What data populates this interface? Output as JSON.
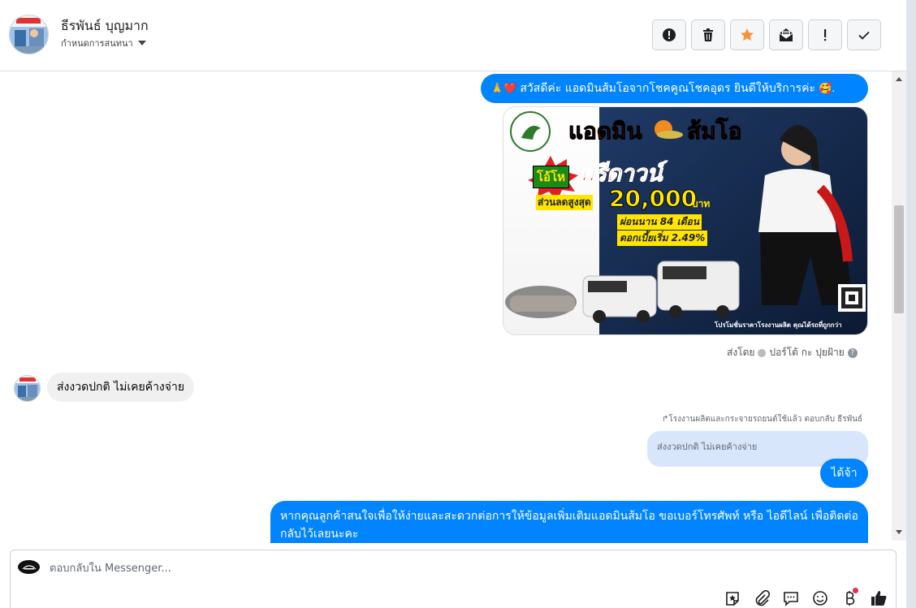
{
  "header": {
    "contact_name": "ธีรพันธ์ บุญมาก",
    "subtitle": "กำหนดการสนทนา",
    "toolbar": [
      {
        "name": "alert-circle-icon"
      },
      {
        "name": "trash-icon"
      },
      {
        "name": "star-icon"
      },
      {
        "name": "mail-open-icon"
      },
      {
        "name": "exclamation-icon"
      },
      {
        "name": "check-icon"
      }
    ]
  },
  "messages": {
    "greeting": {
      "emoji_start": "🙏❤️",
      "text": "สวัสดีค่ะ แอดมินส้มโอจากโชคคูณโชคอุดร ยินดีให้บริการค่ะ",
      "emoji_end": "🥰."
    },
    "promo": {
      "title_1": "แอดมิน",
      "title_2": "ส้มโอ",
      "badge": "โอ้โห",
      "headline": "ฟรีดาวน์",
      "discount_label": "ส่วนลดสูงสุด",
      "discount_amount": "20,000",
      "discount_unit": "บาท",
      "installment": "ผ่อนนาน 84 เดือน",
      "interest": "ดอกเบี้ยเริ่ม 2.49%",
      "footer": "โปรโมชั่นราคาโรงงานผลิต คุณได้รถที่ถูกกว่า"
    },
    "sent_by": {
      "prefix": "ส่งโดย",
      "name": "ปอร์โต้ กะ ปุยฝ้าย"
    },
    "incoming": "ส่งงวดปกติ ไม่เคยค้างจ่าย",
    "reply_note": "↱โรงงานผลิตและกระจายรถยนต์ใช้แล้ว ตอบกลับ ธีรพันธ์",
    "quoted": "ส่งงวดปกติ ไม่เคยค้างจ่าย",
    "reply": "ได้จ้า",
    "long": "หากคุณลูกค้าสนใจเพื่อให้ง่ายและสะดวกต่อการให้ข้อมูลเพิ่มเติมแอดมินส้มโอ ขอเบอร์โทรศัพท์ หรือ ไอดีไลน์ เพื่อติดต่อกลับไว้เลยนะคะ"
  },
  "composer": {
    "placeholder": "ตอบกลับใน Messenger...",
    "icons": [
      "sticker-icon",
      "attachment-icon",
      "saved-reply-icon",
      "emoji-icon",
      "payment-icon",
      "like-icon"
    ]
  },
  "colors": {
    "accent": "#0084ff",
    "incoming_bg": "#f0f0f0",
    "quoted_bg": "#d8e6fb",
    "star": "#f7923a"
  }
}
